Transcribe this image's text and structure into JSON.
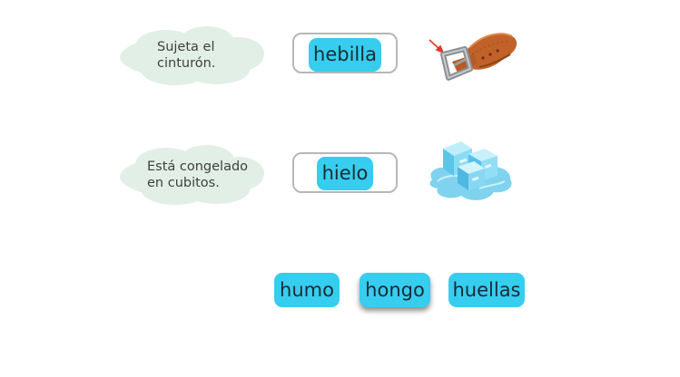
{
  "colors": {
    "chip": "#36cdef",
    "cloud": "#e2efe6",
    "slot_border": "#b7b7b7"
  },
  "items": [
    {
      "clue": "Sujeta el\ncinturón.",
      "answer": "hebilla",
      "image_icon": "belt-icon"
    },
    {
      "clue": "Está congelado\nen cubitos.",
      "answer": "hielo",
      "image_icon": "ice-cubes-icon"
    }
  ],
  "word_bank": [
    "humo",
    "hongo",
    "huellas"
  ]
}
